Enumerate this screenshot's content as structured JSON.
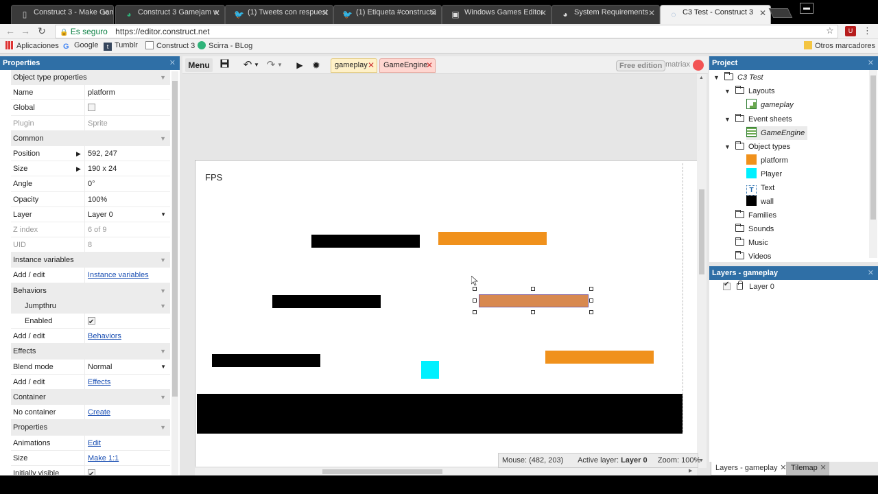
{
  "browser": {
    "tabs": [
      {
        "title": "Construct 3 - Make Gam",
        "icon": "document-icon"
      },
      {
        "title": "Construct 3 Gamejam w",
        "icon": "construct-icon"
      },
      {
        "title": "(1) Tweets con respuest",
        "icon": "twitter-icon"
      },
      {
        "title": "(1) Etiqueta #construct3",
        "icon": "twitter-icon"
      },
      {
        "title": "Windows Games Editor",
        "icon": "game-icon"
      },
      {
        "title": "System Requirements - ",
        "icon": "construct-icon"
      },
      {
        "title": "C3 Test - Construct 3",
        "icon": "loading-icon"
      }
    ],
    "address": {
      "secure_label": "Es seguro",
      "url": "https://editor.construct.net"
    },
    "bookmarks": [
      {
        "label": "Aplicaciones",
        "icon": "apps-icon"
      },
      {
        "label": "Google",
        "icon": "google-icon"
      },
      {
        "label": "Tumblr",
        "icon": "tumblr-icon"
      },
      {
        "label": "Construct 3",
        "icon": "page-icon"
      },
      {
        "label": "Scirra - BLog",
        "icon": "scirra-icon"
      }
    ],
    "other_bookmarks": "Otros marcadores"
  },
  "properties": {
    "title": "Properties",
    "rows": [
      {
        "kind": "sec",
        "label": "Object type properties"
      },
      {
        "kind": "row",
        "label": "Name",
        "value": "platform"
      },
      {
        "kind": "row",
        "label": "Global",
        "checkbox": false
      },
      {
        "kind": "dim",
        "label": "Plugin",
        "value": "Sprite"
      },
      {
        "kind": "sec",
        "label": "Common"
      },
      {
        "kind": "row",
        "label": "Position",
        "value": "592, 247",
        "expand": true
      },
      {
        "kind": "row",
        "label": "Size",
        "value": "190 x 24",
        "expand": true
      },
      {
        "kind": "row",
        "label": "Angle",
        "value": "0°"
      },
      {
        "kind": "row",
        "label": "Opacity",
        "value": "100%"
      },
      {
        "kind": "row",
        "label": "Layer",
        "value": "Layer 0",
        "dropdown": true
      },
      {
        "kind": "dim",
        "label": "Z index",
        "value": "6 of 9"
      },
      {
        "kind": "dim",
        "label": "UID",
        "value": "8"
      },
      {
        "kind": "sec",
        "label": "Instance variables"
      },
      {
        "kind": "row",
        "label": "Add / edit",
        "link": "Instance variables"
      },
      {
        "kind": "sec",
        "label": "Behaviors"
      },
      {
        "kind": "subsec",
        "label": "Jumpthru"
      },
      {
        "kind": "subrow",
        "label": "Enabled",
        "checkbox": true
      },
      {
        "kind": "row",
        "label": "Add / edit",
        "link": "Behaviors"
      },
      {
        "kind": "sec",
        "label": "Effects"
      },
      {
        "kind": "row",
        "label": "Blend mode",
        "value": "Normal",
        "dropdown": true
      },
      {
        "kind": "row",
        "label": "Add / edit",
        "link": "Effects"
      },
      {
        "kind": "sec",
        "label": "Container"
      },
      {
        "kind": "row",
        "label": "No container",
        "link": "Create"
      },
      {
        "kind": "sec",
        "label": "Properties"
      },
      {
        "kind": "row",
        "label": "Animations",
        "link": "Edit"
      },
      {
        "kind": "row",
        "label": "Size",
        "link": "Make 1:1"
      },
      {
        "kind": "row",
        "label": "Initially visible",
        "checkbox": true
      }
    ]
  },
  "toolbar": {
    "menu_label": "Menu",
    "tabs": [
      {
        "label": "gameplay"
      },
      {
        "label": "GameEngine"
      }
    ],
    "edition_label": "Free edition",
    "user_name": "matriax"
  },
  "layout": {
    "fps_text": "FPS",
    "status": {
      "mouse_label": "Mouse:",
      "mouse_value": "(482, 203)",
      "layer_label": "Active layer:",
      "layer_value": "Layer 0",
      "zoom_label": "Zoom:",
      "zoom_value": "100%"
    }
  },
  "project": {
    "title": "Project",
    "root": "C3 Test",
    "folders": {
      "layouts": "Layouts",
      "event_sheets": "Event sheets",
      "object_types": "Object types",
      "families": "Families",
      "sounds": "Sounds",
      "music": "Music",
      "videos": "Videos"
    },
    "layout_item": "gameplay",
    "event_item": "GameEngine",
    "objects": [
      {
        "name": "platform",
        "color": "#f0911c"
      },
      {
        "name": "Player",
        "color": "#00f0ff"
      },
      {
        "name": "Text",
        "color": "#ffffff"
      },
      {
        "name": "wall",
        "color": "#000000"
      }
    ]
  },
  "layers": {
    "title": "Layers - gameplay",
    "items": [
      {
        "name": "Layer 0"
      }
    ],
    "bottom_tabs": [
      {
        "label": "Layers - gameplay"
      },
      {
        "label": "Tilemap"
      }
    ]
  }
}
